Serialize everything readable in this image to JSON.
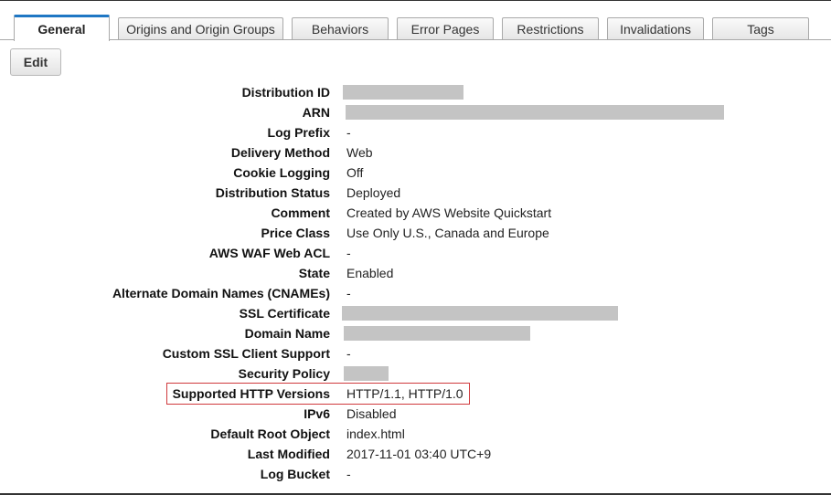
{
  "tabs": [
    {
      "label": "General",
      "active": true
    },
    {
      "label": "Origins and Origin Groups",
      "active": false
    },
    {
      "label": "Behaviors",
      "active": false
    },
    {
      "label": "Error Pages",
      "active": false
    },
    {
      "label": "Restrictions",
      "active": false
    },
    {
      "label": "Invalidations",
      "active": false
    },
    {
      "label": "Tags",
      "active": false
    }
  ],
  "edit_label": "Edit",
  "details": [
    {
      "label": "Distribution ID",
      "value": null,
      "redacted": true
    },
    {
      "label": "ARN",
      "value": null,
      "redacted": true
    },
    {
      "label": "Log Prefix",
      "value": "-"
    },
    {
      "label": "Delivery Method",
      "value": "Web"
    },
    {
      "label": "Cookie Logging",
      "value": "Off"
    },
    {
      "label": "Distribution Status",
      "value": "Deployed"
    },
    {
      "label": "Comment",
      "value": "Created by AWS Website Quickstart"
    },
    {
      "label": "Price Class",
      "value": "Use Only U.S., Canada and Europe"
    },
    {
      "label": "AWS WAF Web ACL",
      "value": "-"
    },
    {
      "label": "State",
      "value": "Enabled"
    },
    {
      "label": "Alternate Domain Names (CNAMEs)",
      "value": "-"
    },
    {
      "label": "SSL Certificate",
      "value": null,
      "redacted": true
    },
    {
      "label": "Domain Name",
      "value": null,
      "redacted": true
    },
    {
      "label": "Custom SSL Client Support",
      "value": "-"
    },
    {
      "label": "Security Policy",
      "value": null,
      "redacted": true
    },
    {
      "label": "Supported HTTP Versions",
      "value": "HTTP/1.1, HTTP/1.0",
      "highlighted": true
    },
    {
      "label": "IPv6",
      "value": "Disabled"
    },
    {
      "label": "Default Root Object",
      "value": "index.html"
    },
    {
      "label": "Last Modified",
      "value": "2017-11-01 03:40 UTC+9"
    },
    {
      "label": "Log Bucket",
      "value": "-"
    }
  ],
  "colors": {
    "active_tab_accent": "#1f77c4",
    "highlight_border": "#d0393d",
    "redaction": "#c4c4c4"
  }
}
